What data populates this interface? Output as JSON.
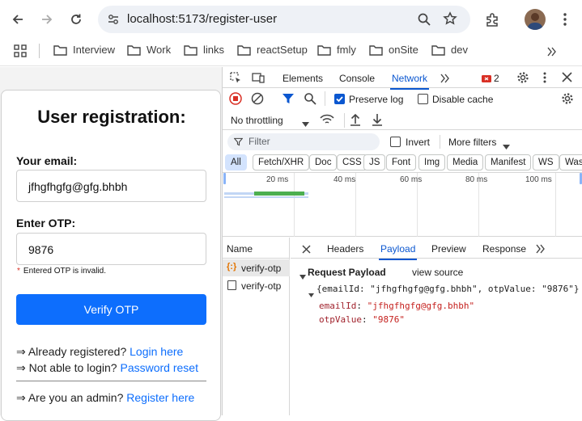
{
  "browser": {
    "url": "localhost:5173/register-user",
    "bookmarks": [
      "Interview",
      "Work",
      "links",
      "reactSetup",
      "fmly",
      "onSite",
      "dev"
    ]
  },
  "page": {
    "title": "User registration:",
    "email_label": "Your email:",
    "email_value": "jfhgfhgfg@gfg.bhbh",
    "otp_label": "Enter OTP:",
    "otp_value": "9876",
    "error_text": "Entered OTP is invalid.",
    "verify_button": "Verify OTP",
    "links": [
      {
        "prefix": "⇒ Already registered? ",
        "link": "Login here"
      },
      {
        "prefix": "⇒ Not able to login? ",
        "link": "Password reset"
      },
      {
        "prefix": "⇒ Are you an admin? ",
        "link": "Register here"
      }
    ]
  },
  "devtools": {
    "tabs": [
      "Elements",
      "Console",
      "Network"
    ],
    "active_tab": "Network",
    "issue_count": "2",
    "preserve_log": "Preserve log",
    "disable_cache": "Disable cache",
    "throttling": "No throttling",
    "filter_placeholder": "Filter",
    "invert": "Invert",
    "more_filters": "More filters",
    "filter_chips": [
      "All",
      "Fetch/XHR",
      "Doc",
      "CSS",
      "JS",
      "Font",
      "Img",
      "Media",
      "Manifest",
      "WS",
      "Wasm"
    ],
    "timeline_ticks": [
      "20 ms",
      "40 ms",
      "60 ms",
      "80 ms",
      "100 ms"
    ],
    "name_header": "Name",
    "requests": [
      "verify-otp",
      "verify-otp"
    ],
    "detail_tabs": [
      "Headers",
      "Payload",
      "Preview",
      "Response"
    ],
    "active_detail_tab": "Payload",
    "payload_title": "Request Payload",
    "view_source": "view source",
    "payload_summary": "{emailId: \"jfhgfhgfg@gfg.bhbh\", otpValue: \"9876\"}",
    "payload_fields": [
      {
        "key": "emailId",
        "value": "\"jfhgfhgfg@gfg.bhbh\""
      },
      {
        "key": "otpValue",
        "value": "\"9876\""
      }
    ]
  }
}
